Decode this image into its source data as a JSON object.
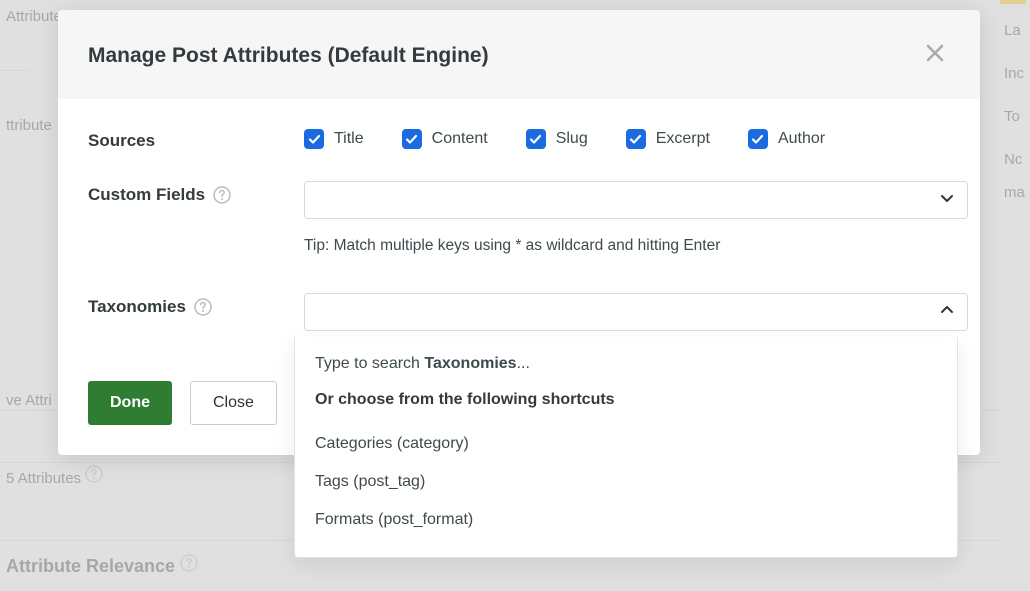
{
  "background": {
    "left_items": [
      "Attribute",
      "ttribute"
    ],
    "ve_label": "ve Attri",
    "mid_label": "5 Attributes",
    "bottom_label": "Attribute Relevance",
    "right_items": [
      "La",
      "Inc",
      "To",
      "Nc",
      "ma"
    ]
  },
  "modal": {
    "title": "Manage Post Attributes (Default Engine)",
    "sources_label": "Sources",
    "sources_checks": [
      "Title",
      "Content",
      "Slug",
      "Excerpt",
      "Author"
    ],
    "custom_fields_label": "Custom Fields",
    "custom_fields_tip": "Tip: Match multiple keys using * as wildcard and hitting Enter",
    "taxonomies_label": "Taxonomies",
    "done_label": "Done",
    "close_label": "Close"
  },
  "dropdown": {
    "search_prefix": "Type to search ",
    "search_bold": "Taxonomies",
    "search_suffix": "...",
    "heading": "Or choose from the following shortcuts",
    "items": [
      "Categories (category)",
      "Tags (post_tag)",
      "Formats (post_format)"
    ]
  }
}
